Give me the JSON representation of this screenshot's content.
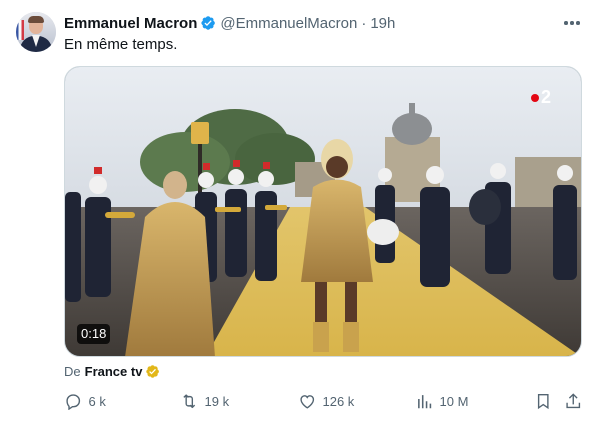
{
  "author": {
    "name": "Emmanuel Macron",
    "handle": "@EmmanuelMacron",
    "separator": "·",
    "time": "19h",
    "avatar_icon": "profile-photo",
    "verified_color": "#1d9bf0"
  },
  "tweet": {
    "text": "En même temps."
  },
  "media": {
    "type": "video",
    "duration": "0:18",
    "channel_logo": "2"
  },
  "source": {
    "prefix": "De",
    "name": "France tv",
    "badge_color": "#e2b719"
  },
  "actions": {
    "replies": "6 k",
    "retweets": "19 k",
    "likes": "126 k",
    "views": "10 M"
  },
  "colors": {
    "text_primary": "#0f1419",
    "text_secondary": "#536471",
    "border": "#cfd9de",
    "accent": "#1d9bf0"
  }
}
